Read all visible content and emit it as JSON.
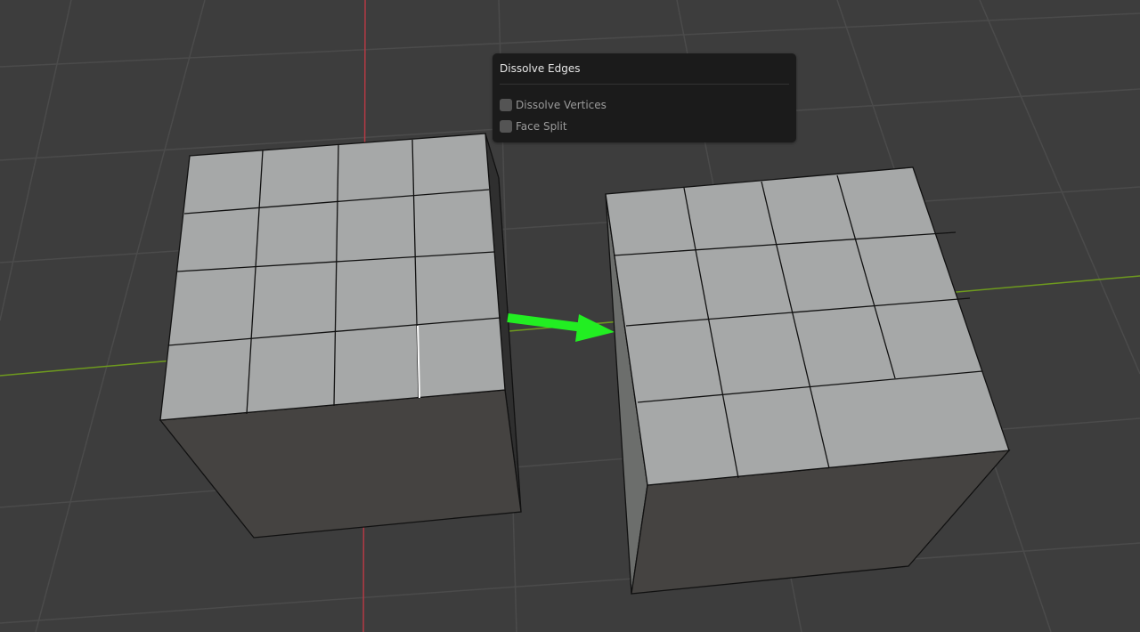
{
  "operator_panel": {
    "title": "Dissolve Edges",
    "options": [
      {
        "label": "Dissolve Vertices",
        "checked": false
      },
      {
        "label": "Face Split",
        "checked": false
      }
    ]
  },
  "colors": {
    "background": "#3d3d3d",
    "grid": "#4b4b4b",
    "x_axis": "#b33a44",
    "y_axis": "#6e9a1e",
    "face": "#a6a8a8",
    "arrow": "#22ee22"
  }
}
